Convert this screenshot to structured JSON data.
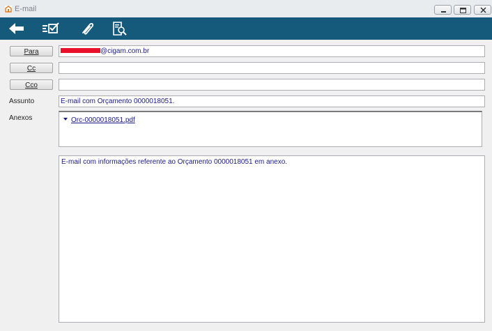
{
  "window": {
    "title": "E-mail",
    "icon": "app-icon"
  },
  "toolbar": {
    "items": [
      {
        "name": "back-arrow-icon"
      },
      {
        "name": "send-checklist-icon"
      },
      {
        "name": "paperclip-icon"
      },
      {
        "name": "document-search-icon"
      }
    ],
    "background": "#155a7b"
  },
  "form": {
    "para_label": "Para",
    "cc_label": "Cc",
    "cco_label": "Cco",
    "para_value_domain": "@cigam.com.br",
    "cc_value": "",
    "cco_value": "",
    "assunto_label": "Assunto",
    "assunto_value": "E-mail com Orçamento 0000018051.",
    "anexos_label": "Anexos",
    "attachments": [
      "Orc-0000018051.pdf"
    ],
    "body": "E-mail com informações referente ao Orçamento 0000018051 em anexo."
  },
  "colors": {
    "text_blue": "#1a1a8a",
    "redaction": "#e8102b"
  }
}
